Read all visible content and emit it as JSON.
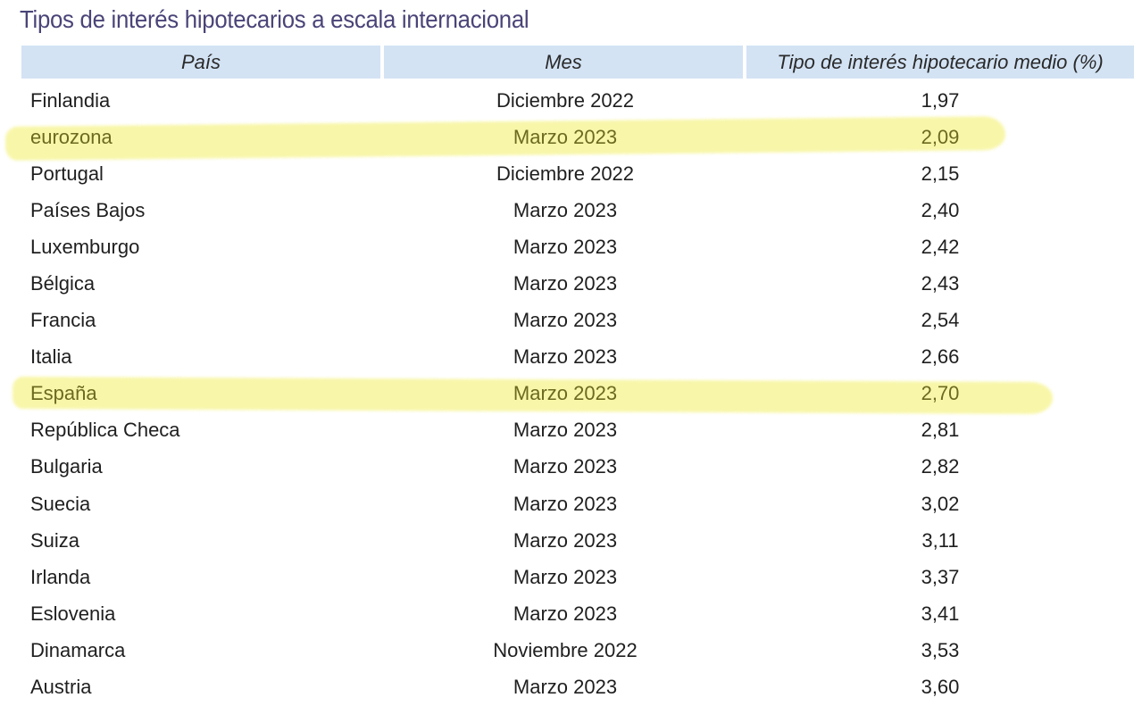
{
  "title": "Tipos de interés hipotecarios a escala internacional",
  "table": {
    "headers": {
      "country": "País",
      "month": "Mes",
      "rate": "Tipo de interés hipotecario medio (%)"
    },
    "highlight_color": "#f7f59a",
    "header_bg_color": "#d3e3f4",
    "title_color": "#4a4478",
    "rows": [
      {
        "country": "Finlandia",
        "month": "Diciembre 2022",
        "rate": "1,97",
        "highlighted": false
      },
      {
        "country": "eurozona",
        "month": "Marzo 2023",
        "rate": "2,09",
        "highlighted": true
      },
      {
        "country": "Portugal",
        "month": "Diciembre 2022",
        "rate": "2,15",
        "highlighted": false
      },
      {
        "country": "Países Bajos",
        "month": "Marzo 2023",
        "rate": "2,40",
        "highlighted": false
      },
      {
        "country": "Luxemburgo",
        "month": "Marzo 2023",
        "rate": "2,42",
        "highlighted": false
      },
      {
        "country": "Bélgica",
        "month": "Marzo 2023",
        "rate": "2,43",
        "highlighted": false
      },
      {
        "country": "Francia",
        "month": "Marzo 2023",
        "rate": "2,54",
        "highlighted": false
      },
      {
        "country": "Italia",
        "month": "Marzo 2023",
        "rate": "2,66",
        "highlighted": false
      },
      {
        "country": "España",
        "month": "Marzo 2023",
        "rate": "2,70",
        "highlighted": true
      },
      {
        "country": "República Checa",
        "month": "Marzo 2023",
        "rate": "2,81",
        "highlighted": false
      },
      {
        "country": "Bulgaria",
        "month": "Marzo 2023",
        "rate": "2,82",
        "highlighted": false
      },
      {
        "country": "Suecia",
        "month": "Marzo 2023",
        "rate": "3,02",
        "highlighted": false
      },
      {
        "country": "Suiza",
        "month": "Marzo 2023",
        "rate": "3,11",
        "highlighted": false
      },
      {
        "country": "Irlanda",
        "month": "Marzo 2023",
        "rate": "3,37",
        "highlighted": false
      },
      {
        "country": "Eslovenia",
        "month": "Marzo 2023",
        "rate": "3,41",
        "highlighted": false
      },
      {
        "country": "Dinamarca",
        "month": "Noviembre 2022",
        "rate": "3,53",
        "highlighted": false
      },
      {
        "country": "Austria",
        "month": "Marzo 2023",
        "rate": "3,60",
        "highlighted": false
      }
    ]
  }
}
